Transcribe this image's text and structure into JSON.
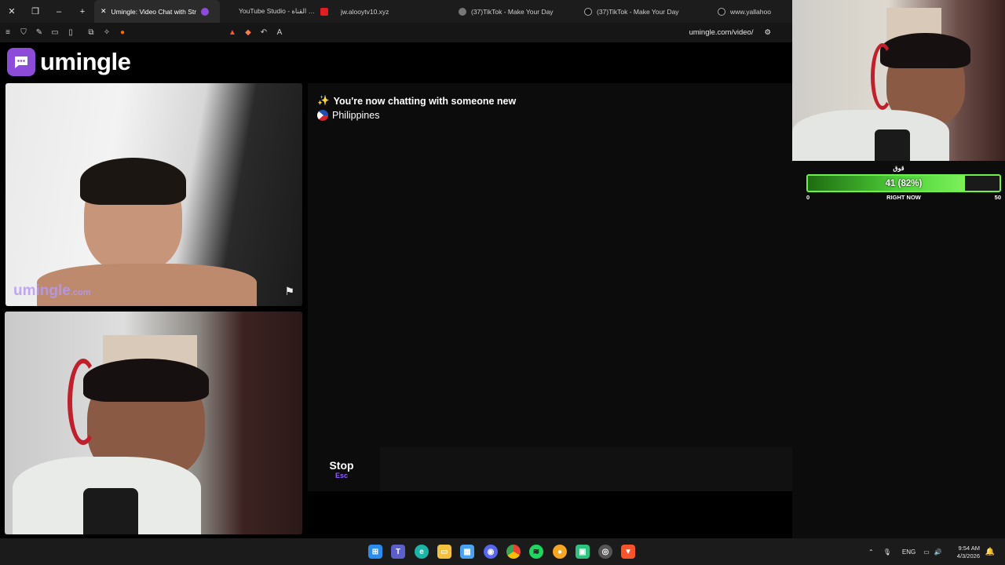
{
  "browser": {
    "tabs": [
      {
        "title": "Umingle: Video Chat with Str",
        "active": true,
        "favicon": "umingle-icon"
      },
      {
        "title": "YouTube Studio - محتوى القناة",
        "active": false,
        "favicon": "youtube-icon"
      },
      {
        "title": "jw.alooytv10.xyz",
        "active": false,
        "favicon": "globe-icon"
      },
      {
        "title": "(37)TikTok - Make Your Day",
        "active": false,
        "favicon": "tiktok-icon"
      },
      {
        "title": "(37)TikTok - Make Your Day",
        "active": false,
        "favicon": "tiktok-icon"
      },
      {
        "title": "www.yallahoo",
        "active": false,
        "favicon": "globe-icon"
      }
    ],
    "url": "umingle.com/video/"
  },
  "page": {
    "logo_text": "umingle",
    "remote_watermark": "umingle",
    "remote_watermark_suffix": ".com",
    "chat": {
      "status_message": "You're now chatting with someone new",
      "country": "Philippines"
    },
    "stop_button": {
      "label": "Stop",
      "shortcut": "Esc"
    },
    "message_input": {
      "placeholder": ""
    }
  },
  "stream_overlay": {
    "goal_title": "قوق",
    "goal_current": 41,
    "goal_percent": 82,
    "goal_text": "41 (82%)",
    "goal_min": "0",
    "goal_center_label": "RIGHT NOW",
    "goal_max": "50"
  },
  "taskbar": {
    "language": "ENG",
    "time": "9:54 AM",
    "date": "4/3/2026"
  },
  "colors": {
    "brand": "#8d4bd9",
    "goal_border": "#6ef04a",
    "stop_key": "#8f5bff"
  }
}
